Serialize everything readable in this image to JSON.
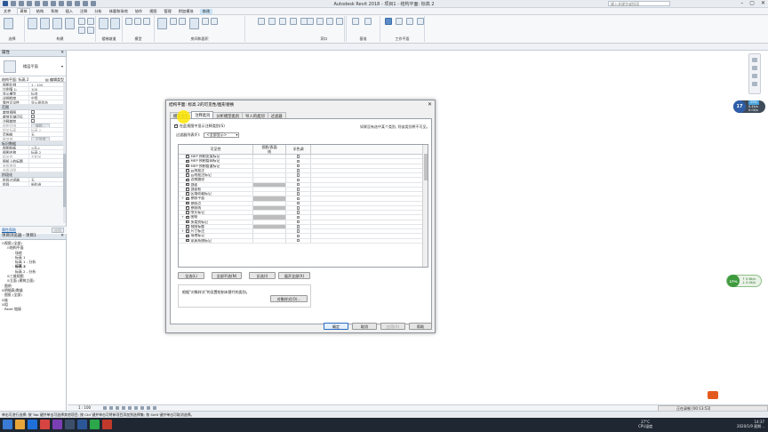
{
  "window": {
    "title": "Autodesk Revit 2018 -    项目1 - 结构平面: 标高 2",
    "search_placeholder": "键入关键字或短语"
  },
  "menu_tabs": [
    "文件",
    "建筑",
    "结构",
    "系统",
    "插入",
    "注释",
    "分析",
    "体量和场地",
    "协作",
    "视图",
    "管理",
    "附加模块",
    "修改"
  ],
  "menu_active": "建筑",
  "ribbon_groups": [
    "选择",
    "构建",
    "楼梯坡道",
    "模型",
    "房间和面积",
    "洞口",
    "基准",
    "工作平面"
  ],
  "properties": {
    "title": "属性",
    "type_name": "楼层平面",
    "selector": "结构平面: 标高 2",
    "edit_type": "编辑类型",
    "rows_top": [
      {
        "k": "视图比例",
        "v": "1 : 100"
      },
      {
        "k": "比例值 1:",
        "v": "100"
      },
      {
        "k": "显示模型",
        "v": "标准"
      },
      {
        "k": "详细程度",
        "v": "中等"
      },
      {
        "k": "零件可见性",
        "v": "显示原状态"
      }
    ],
    "cat_range": "范围",
    "rows_range": [
      {
        "k": "裁剪视图",
        "cb": true
      },
      {
        "k": "裁剪区域可见",
        "cb": true
      },
      {
        "k": "注释裁剪",
        "cb": true
      },
      {
        "k": "视图范围",
        "btn": "编辑...",
        "dis": true
      },
      {
        "k": "相关标高",
        "v": "标高 2",
        "dis": true
      },
      {
        "k": "范围框",
        "v": "无"
      },
      {
        "k": "截剪裁",
        "btn": "不剪裁",
        "dis": true
      }
    ],
    "cat_identity": "标识数据",
    "rows_identity": [
      {
        "k": "视图样板",
        "v": "<无>"
      },
      {
        "k": "视图名称",
        "v": "标高 2"
      },
      {
        "k": "相关性",
        "v": "不相关",
        "dis": true
      },
      {
        "k": "图纸上的标题",
        "v": ""
      },
      {
        "k": "参照图纸",
        "v": "",
        "dis": true
      },
      {
        "k": "参照详图",
        "v": "",
        "dis": true
      }
    ],
    "cat_phase": "阶段化",
    "rows_phase": [
      {
        "k": "阶段过滤器",
        "v": "无"
      },
      {
        "k": "阶段",
        "v": "新构造"
      }
    ],
    "help_link": "属性帮助",
    "apply": "应用"
  },
  "browser": {
    "title": "项目浏览器 - 项目1",
    "items": [
      {
        "t": "⊟",
        "label": "视图 (全部)",
        "lvl": 0
      },
      {
        "t": "⊟",
        "label": "结构平面",
        "lvl": 1
      },
      {
        "t": "",
        "label": "场地",
        "lvl": 2
      },
      {
        "t": "",
        "label": "标高 1",
        "lvl": 2
      },
      {
        "t": "",
        "label": "标高 1 - 分析",
        "lvl": 2
      },
      {
        "t": "",
        "label": "标高 2",
        "lvl": 2,
        "bold": true
      },
      {
        "t": "",
        "label": "标高 2 - 分析",
        "lvl": 2
      },
      {
        "t": "⊞",
        "label": "三维视图",
        "lvl": 1
      },
      {
        "t": "⊞",
        "label": "立面 (建筑立面)",
        "lvl": 1
      },
      {
        "t": "",
        "label": "图例",
        "lvl": 0
      },
      {
        "t": "⊞",
        "label": "明细表/数量",
        "lvl": 0
      },
      {
        "t": "",
        "label": "图纸 (全部)",
        "lvl": 0
      },
      {
        "t": "⊞",
        "label": "族",
        "lvl": 0
      },
      {
        "t": "⊞",
        "label": "组",
        "lvl": 0
      },
      {
        "t": "",
        "label": "Revit 链接",
        "lvl": 0
      }
    ]
  },
  "perf": {
    "cpu_pct": "17",
    "a_pct": "29%",
    "mem": "0.4k/s",
    "net": "0.0k/s",
    "cpu2": "17%",
    "up": "0.6k/s",
    "down": "0.0k/s"
  },
  "view_scale": "1 : 100",
  "status_text": "单击可进行选择; 按 Tab 键并单击可选择其他项目; 按 Ctrl 键并单击可将新项目添加到选择集; 按 Shift 键并单击可取消选择。",
  "ime_text": "正在录制 [00:13:53]",
  "dialog": {
    "title": "结构平面: 标高 2的可见性/图形替换",
    "tabs": [
      "模型类别",
      "注释类别",
      "分析模型类别",
      "导入的类别",
      "过滤器"
    ],
    "active_tab": "注释类别",
    "show_annotations": "在此视图中显示注释类别(S)",
    "note": "如果没有选中某个类别, 则该类别将不可见。",
    "filter_label": "过滤器列表(F):",
    "filter_value": "<全部显示>",
    "col_visibility": "可见性",
    "col_projection": "投影/表面",
    "col_projection_sub": "线",
    "col_halftone": "半色调",
    "rows": [
      {
        "exp": "",
        "label": "MEP 预制支架标记",
        "gray": false
      },
      {
        "exp": "",
        "label": "MEP 预制管网标记",
        "gray": false
      },
      {
        "exp": "",
        "label": "MEP 预制管道标记",
        "gray": false
      },
      {
        "exp": "",
        "label": "云线批注",
        "gray": false
      },
      {
        "exp": "",
        "label": "云线批注标记",
        "gray": false
      },
      {
        "exp": "",
        "label": "边缘路径",
        "gray": false
      },
      {
        "exp": "",
        "label": "剖面",
        "gray": true
      },
      {
        "exp": "",
        "label": "剖面框",
        "gray": false
      },
      {
        "exp": "",
        "label": "区域荷载标记",
        "gray": false
      },
      {
        "exp": "+",
        "label": "参照平面",
        "gray": true
      },
      {
        "exp": "",
        "label": "参照点",
        "gray": false
      },
      {
        "exp": "",
        "label": "参照线",
        "gray": true
      },
      {
        "exp": "",
        "label": "喷头标记",
        "gray": false
      },
      {
        "exp": "+",
        "label": "图框",
        "gray": true
      },
      {
        "exp": "",
        "label": "多类别标记",
        "gray": false
      },
      {
        "exp": "",
        "label": "视图标题",
        "gray": true
      },
      {
        "exp": "+",
        "label": "尺寸标注",
        "gray": false
      },
      {
        "exp": "",
        "label": "场地标记",
        "gray": false
      },
      {
        "exp": "",
        "label": "家具系统标记",
        "gray": false
      }
    ],
    "btn_all": "全选(L)",
    "btn_none": "全部不选(N)",
    "btn_invert": "反选(I)",
    "btn_expand": "展开全部(X)",
    "override_text": "根据\"对象样式\"的设置绘制未替代的类别。",
    "btn_object_styles": "对象样式(O)...",
    "btn_ok": "确定",
    "btn_cancel": "取消",
    "btn_apply": "应用(A)",
    "btn_help": "帮助"
  },
  "clock": {
    "time": "14:37",
    "date": "2020/1/9 星期..."
  },
  "tray": {
    "temp": "27°C",
    "cpu_label": "CPU温度"
  }
}
